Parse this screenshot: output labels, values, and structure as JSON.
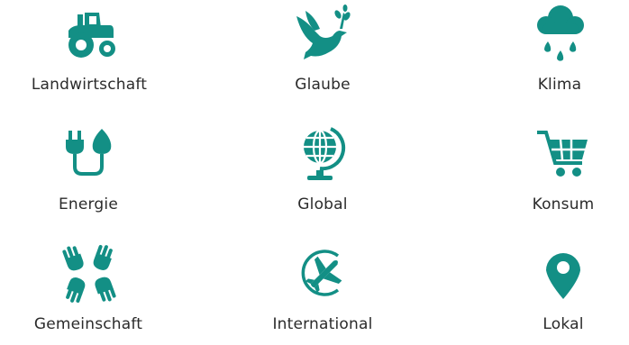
{
  "theme": {
    "icon_color": "#138f85",
    "text_color": "#2b2b2b"
  },
  "categories": [
    {
      "label": "Landwirtschaft",
      "icon": "tractor-icon"
    },
    {
      "label": "Glaube",
      "icon": "dove-icon"
    },
    {
      "label": "Klima",
      "icon": "rain-cloud-icon"
    },
    {
      "label": "Energie",
      "icon": "plug-leaf-icon"
    },
    {
      "label": "Global",
      "icon": "globe-icon"
    },
    {
      "label": "Konsum",
      "icon": "shopping-cart-icon"
    },
    {
      "label": "Gemeinschaft",
      "icon": "hands-icon"
    },
    {
      "label": "International",
      "icon": "airplane-icon"
    },
    {
      "label": "Lokal",
      "icon": "map-pin-icon"
    }
  ]
}
